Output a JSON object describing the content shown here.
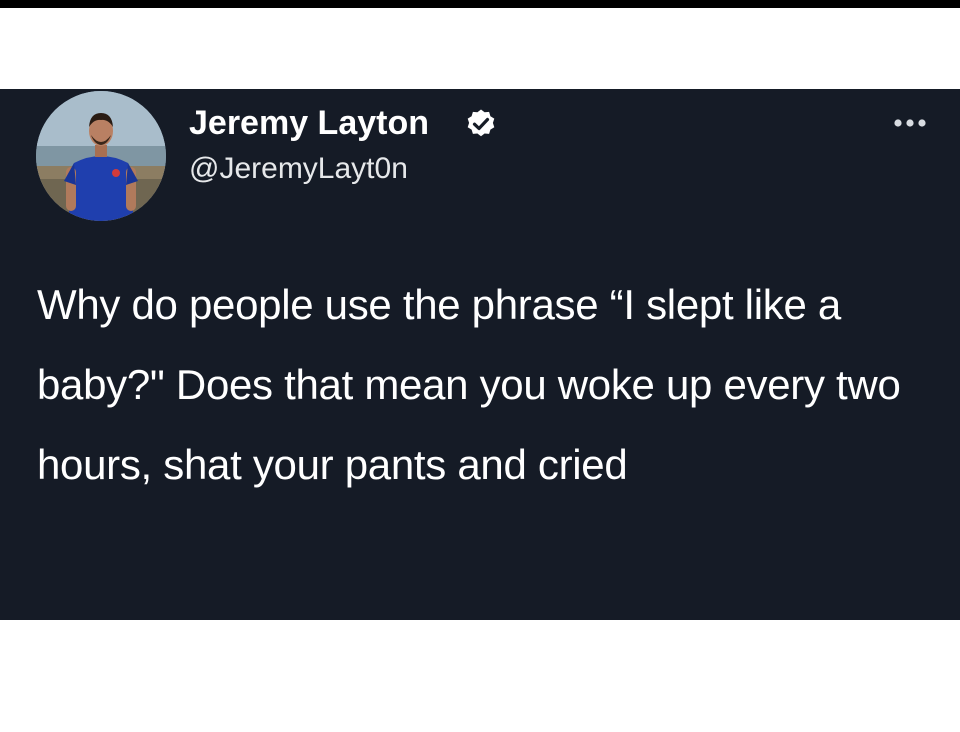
{
  "tweet": {
    "display_name": "Jeremy Layton",
    "handle": "@JeremyLayt0n",
    "verified": true,
    "text": "Why do people use the phrase “I slept like a baby?\" Does that mean you woke up every two hours, shat your pants and cried"
  },
  "icons": {
    "verified": "verified-badge-icon",
    "more": "more-options-icon",
    "avatar": "profile-avatar"
  },
  "colors": {
    "card_background": "#151b26",
    "text": "#ffffff",
    "page_background": "#ffffff"
  }
}
